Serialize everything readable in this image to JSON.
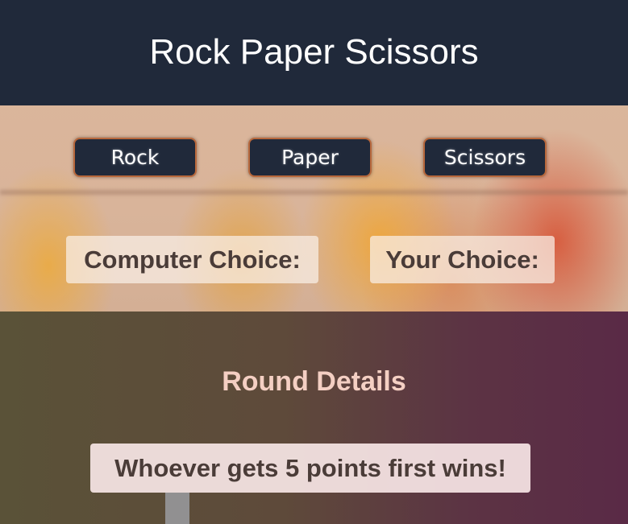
{
  "header": {
    "title": "Rock Paper Scissors"
  },
  "choices": {
    "rock_label": "Rock",
    "paper_label": "Paper",
    "scissors_label": "Scissors"
  },
  "labels": {
    "computer_choice": "Computer Choice:",
    "your_choice": "Your Choice:"
  },
  "round": {
    "title": "Round Details",
    "message": "Whoever gets 5 points first wins!"
  },
  "colors": {
    "header_bg": "#20293a",
    "button_bg": "#20293a",
    "button_border": "#b8683c",
    "round_title": "#f4cfc3"
  }
}
